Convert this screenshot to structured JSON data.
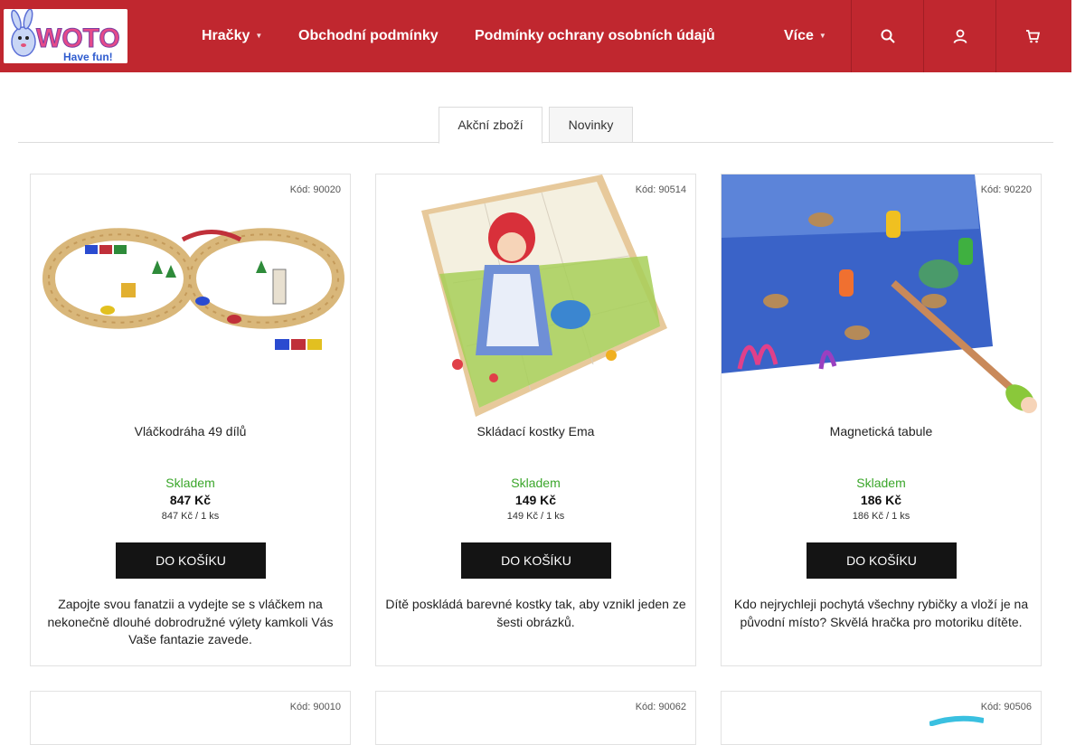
{
  "header": {
    "logo": {
      "text": "WOTO",
      "tagline": "Have fun!"
    },
    "nav": [
      {
        "label": "Hračky",
        "has_dropdown": true
      },
      {
        "label": "Obchodní podmínky",
        "has_dropdown": false
      },
      {
        "label": "Podmínky ochrany osobních údajů",
        "has_dropdown": false
      },
      {
        "label": "Více",
        "has_dropdown": true
      }
    ],
    "icon_buttons": [
      "search-icon",
      "user-icon",
      "cart-icon"
    ]
  },
  "tabs": [
    {
      "label": "Akční zboží",
      "active": true
    },
    {
      "label": "Novinky",
      "active": false
    }
  ],
  "products": [
    {
      "code": "Kód: 90020",
      "name": "Vláčkodráha 49 dílů",
      "stock": "Skladem",
      "price": "847 Kč",
      "unit_price": "847 Kč / 1 ks",
      "button": "Do košíku",
      "description": "Zapojte svou fanatzii a vydejte se s vláčkem na nekonečně dlouhé dobrodružné výlety kamkoli Vás Vaše fantazie zavede."
    },
    {
      "code": "Kód: 90514",
      "name": "Skládací kostky Ema",
      "stock": "Skladem",
      "price": "149 Kč",
      "unit_price": "149 Kč / 1 ks",
      "button": "Do košíku",
      "description": "Dítě poskládá barevné kostky tak, aby vznikl jeden ze šesti obrázků."
    },
    {
      "code": "Kód: 90220",
      "name": "Magnetická tabule",
      "stock": "Skladem",
      "price": "186 Kč",
      "unit_price": "186 Kč / 1 ks",
      "button": "Do košíku",
      "description": "Kdo nejrychleji pochytá všechny rybičky a vloží je na původní místo? Skvělá hračka pro motoriku dítěte."
    }
  ],
  "products_row2": [
    {
      "code": "Kód: 90010"
    },
    {
      "code": "Kód: 90062"
    },
    {
      "code": "Kód: 90506"
    }
  ],
  "colors": {
    "header_bg": "#c0272f",
    "stock_green": "#3aa62a",
    "button_bg": "#141414"
  }
}
